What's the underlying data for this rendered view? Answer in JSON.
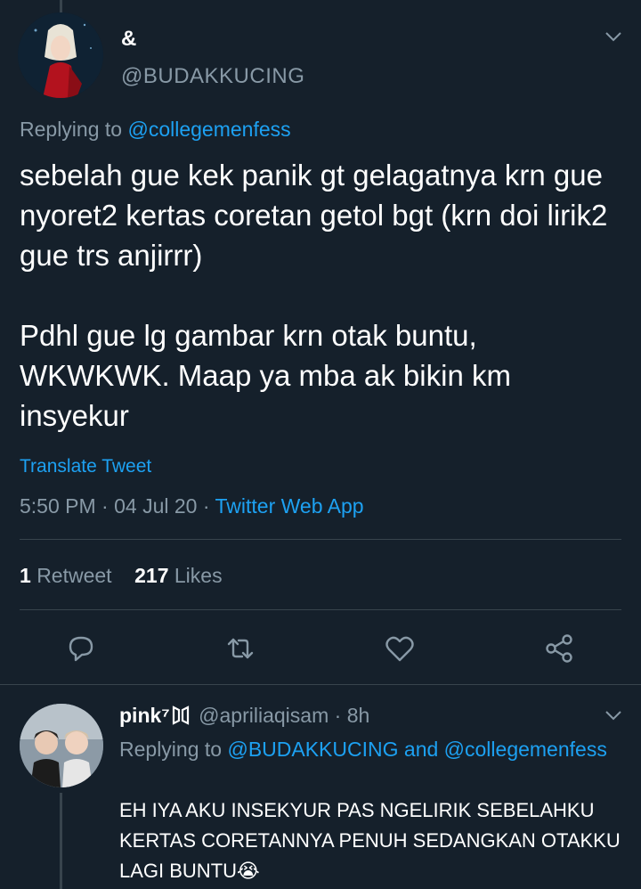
{
  "tweet": {
    "display_name": "&",
    "handle": "@BUDAKKUCING",
    "replying_prefix": "Replying to ",
    "replying_handle": "@collegemenfess",
    "text": "sebelah gue kek panik gt gelagatnya krn gue nyoret2 kertas coretan getol bgt (krn doi lirik2 gue trs anjirrr)\n\nPdhl gue lg gambar krn otak buntu, WKWKWK. Maap ya mba ak bikin km insyekur",
    "translate_label": "Translate Tweet",
    "time": "5:50 PM",
    "date": "04 Jul 20",
    "source": "Twitter Web App",
    "retweet_count": "1",
    "retweet_label": "Retweet",
    "like_count": "217",
    "like_label": "Likes"
  },
  "reply": {
    "display_name": "pink⁷",
    "handle": "@apriliaqisam",
    "age": "8h",
    "replying_prefix": "Replying to ",
    "replying_handles": "@BUDAKKUCING and @collegemenfess",
    "text": "EH IYA AKU INSEKYUR PAS NGELIRIK SEBELAHKU KERTAS CORETANNYA PENUH SEDANGKAN OTAKKU LAGI BUNTU😭"
  },
  "colors": {
    "background": "#15202b",
    "accent": "#1da1f2",
    "muted": "#8899a6",
    "divider": "#38444d"
  }
}
